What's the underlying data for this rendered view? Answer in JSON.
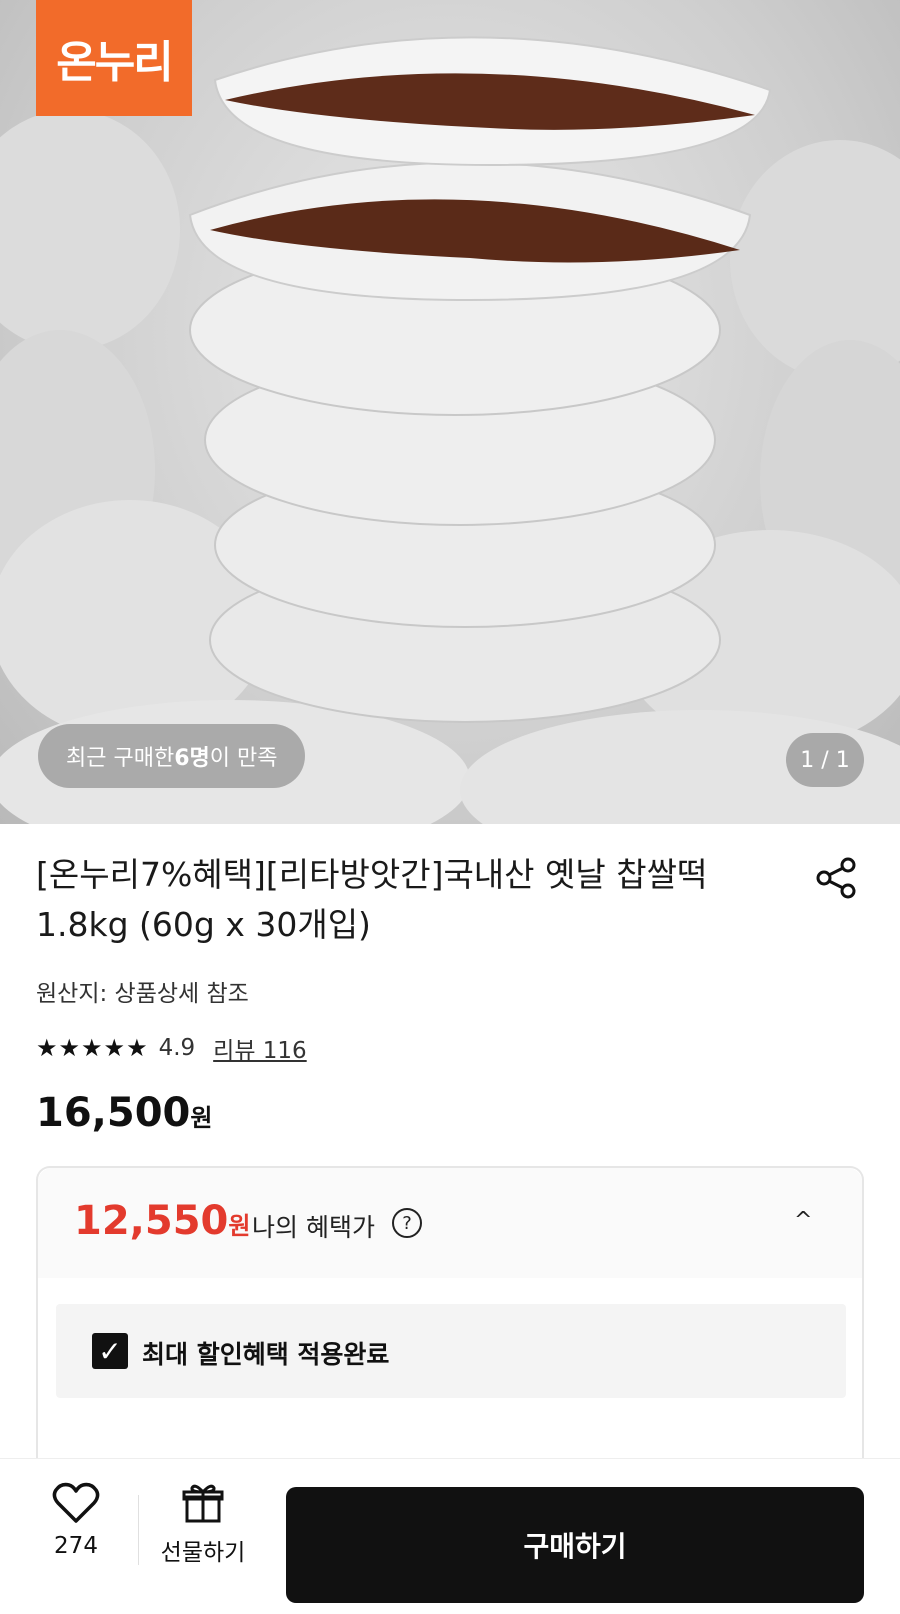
{
  "brand": {
    "logo_text": "온누리",
    "logo_color": "#f26b2a"
  },
  "hero": {
    "buyers_prefix": "최근 구매한 ",
    "buyers_count": "6명",
    "buyers_suffix": "이 만족",
    "page_indicator": "1 / 1"
  },
  "product": {
    "title": "[온누리7%혜택][리타방앗간]국내산 옛날 찹쌀떡 1.8kg (60g x 30개입)",
    "origin": "원산지: 상품상세 참조",
    "stars": "★★★★★",
    "rating": "4.9",
    "reviews_label": "리뷰 116",
    "price": "16,500",
    "price_unit": "원"
  },
  "benefit": {
    "price": "12,550",
    "price_unit": "원",
    "label": "나의 혜택가",
    "help_symbol": "?",
    "chevron_symbol": "^",
    "applied_label": "최대 할인혜택 적용완료",
    "check_symbol": "✓",
    "accent_color": "#e33a2d"
  },
  "bottom_bar": {
    "like_count": "274",
    "gift_label": "선물하기",
    "buy_label": "구매하기"
  }
}
